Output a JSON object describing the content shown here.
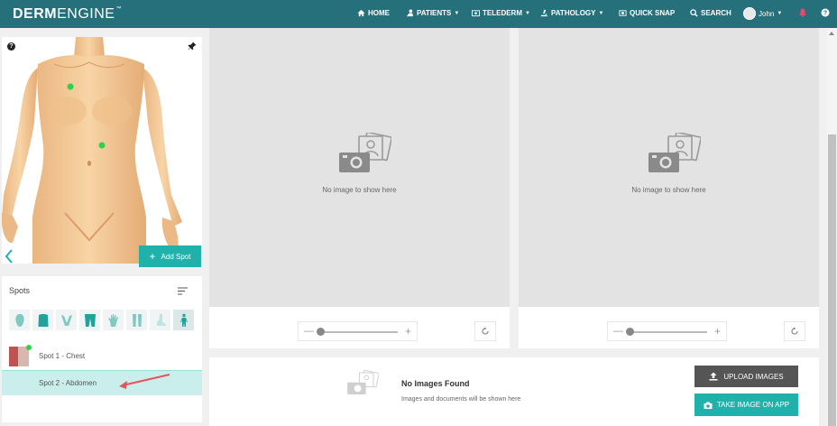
{
  "app": {
    "logo_bold": "DERM",
    "logo_light": "ENGINE",
    "logo_tm": "™"
  },
  "nav": {
    "home": "HOME",
    "patients": "PATIENTS",
    "telederm": "TELEDERM",
    "pathology": "PATHOLOGY",
    "quick_snap": "QUICK SNAP",
    "search": "SEARCH",
    "user": "John"
  },
  "left_panel": {
    "help_symbol": "?",
    "add_spot_label": "Add Spot",
    "spots_title": "Spots",
    "regions": [
      "head-icon",
      "torso-icon",
      "neck-icon",
      "legs-icon",
      "hand-icon",
      "lower-legs-icon",
      "foot-icon",
      "full-body-icon"
    ],
    "spots": [
      {
        "label": "Spot 1 - Chest"
      },
      {
        "label": "Spot 2 - Abdomen"
      }
    ]
  },
  "viewers": {
    "left": {
      "empty_text": "No image to show here"
    },
    "right": {
      "empty_text": "No image to show here"
    },
    "zoom_minus": "—",
    "zoom_plus": "+"
  },
  "upload": {
    "title": "No Images Found",
    "subtitle": "Images and documents will be shown here",
    "upload_button": "UPLOAD IMAGES",
    "take_button": "TAKE IMAGE ON APP"
  },
  "colors": {
    "topbar": "#25707a",
    "accent": "#20b2aa",
    "spot_marker": "#2bd34a"
  }
}
